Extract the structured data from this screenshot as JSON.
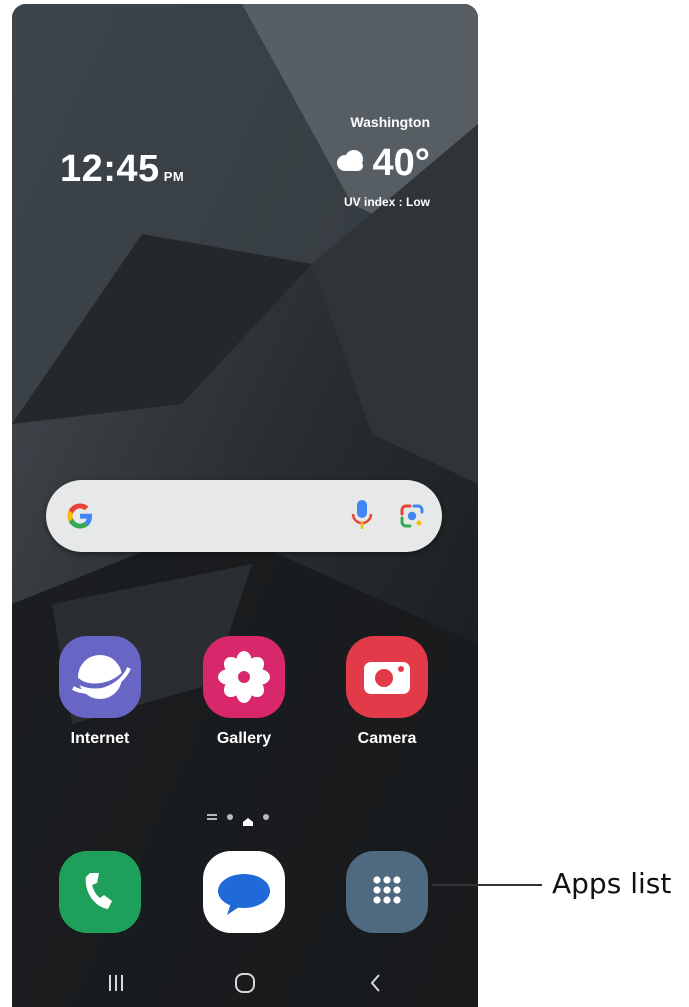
{
  "status": {
    "time": "12:45",
    "ampm": "PM"
  },
  "weather": {
    "city": "Washington",
    "temperature": "40°",
    "uv": "UV index : Low",
    "icon": "cloud-icon"
  },
  "search_bar": {
    "logo": "google-g-icon",
    "voice": "microphone-icon",
    "lens": "google-lens-icon"
  },
  "apps": [
    {
      "label": "Internet",
      "icon": "internet-icon",
      "color": "#6866c4"
    },
    {
      "label": "Gallery",
      "icon": "gallery-flower-icon",
      "color": "#d8276a"
    },
    {
      "label": "Camera",
      "icon": "camera-icon",
      "color": "#e33a4a"
    }
  ],
  "dock": [
    {
      "icon": "phone-icon",
      "color": "#1fa05a"
    },
    {
      "icon": "messages-icon",
      "color": "#ffffff"
    },
    {
      "icon": "apps-grid-icon",
      "color": "#4f6a80"
    }
  ],
  "page_indicator": {
    "pages": 4,
    "current": 2
  },
  "nav": {
    "recents": "recents-icon",
    "home": "home-icon",
    "back": "back-icon"
  },
  "callout": {
    "label": "Apps list"
  }
}
